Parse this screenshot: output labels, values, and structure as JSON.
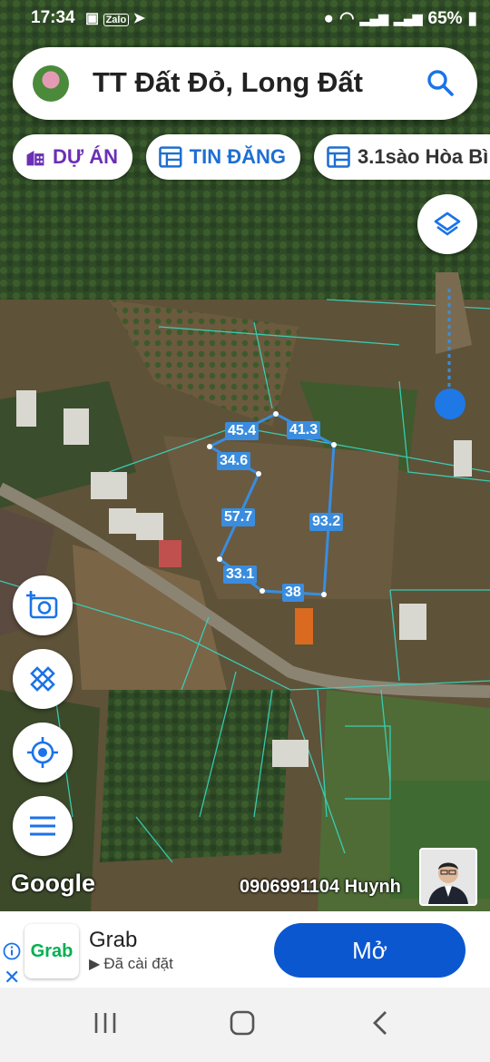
{
  "status_bar": {
    "time": "17:34",
    "battery": "65%",
    "left_icons": [
      "image-icon",
      "zalo-icon",
      "send-icon"
    ],
    "right_icons": [
      "location-icon",
      "wifi-icon",
      "signal-icon",
      "signal-icon",
      "battery-icon"
    ]
  },
  "search": {
    "title": "TT Đất Đỏ, Long Đất"
  },
  "chips": [
    {
      "label": "DỰ ÁN",
      "icon": "building-icon",
      "color": "#6b2fb5"
    },
    {
      "label": "TIN ĐĂNG",
      "icon": "listing-icon",
      "color": "#1e6fd1"
    },
    {
      "label": "3.1sào Hòa Bì",
      "icon": "listing-icon",
      "color": "#333333"
    }
  ],
  "plot": {
    "edges": [
      "45.4",
      "41.3",
      "34.6",
      "93.2",
      "57.7",
      "33.1",
      "38"
    ],
    "line_color": "#3a8dde"
  },
  "map": {
    "attribution": "Google",
    "contact": "0906991104 Huynh"
  },
  "ad": {
    "app_name": "Grab",
    "logo_text": "Grab",
    "status": "Đã cài đặt",
    "button": "Mở"
  }
}
